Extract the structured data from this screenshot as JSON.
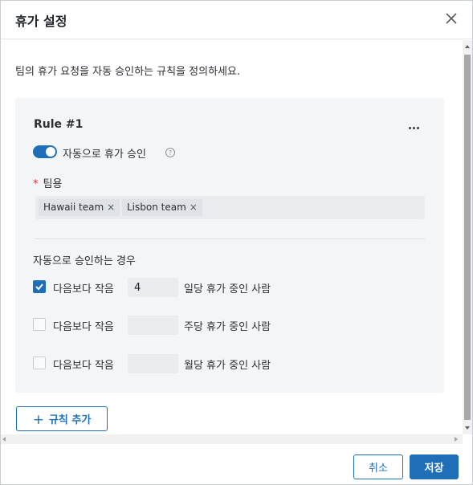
{
  "dialog": {
    "title": "휴가 설정",
    "description": "팀의 휴가 요청을 자동 승인하는 규칙을 정의하세요."
  },
  "rule": {
    "title": "Rule #1",
    "auto_approve_label": "자동으로 휴가 승인",
    "auto_approve_enabled": true,
    "help_glyph": "?",
    "required_marker": "*",
    "teams_label": "팀용",
    "teams": [
      {
        "name": "Hawaii team",
        "remove": "×"
      },
      {
        "name": "Lisbon team",
        "remove": "×"
      }
    ],
    "conditions_heading": "자동으로 승인하는 경우",
    "conditions": [
      {
        "checked": true,
        "prefix": "다음보다 작음",
        "value": "4",
        "suffix": "일당 휴가 중인 사람"
      },
      {
        "checked": false,
        "prefix": "다음보다 작음",
        "value": "",
        "suffix": "주당 휴가 중인 사람"
      },
      {
        "checked": false,
        "prefix": "다음보다 작음",
        "value": "",
        "suffix": "월당 휴가 중인 사람"
      }
    ]
  },
  "add_rule": {
    "plus": "+",
    "label": "규칙 추가"
  },
  "footer": {
    "cancel_label": "취소",
    "save_label": "저장"
  },
  "colors": {
    "accent": "#1f6fb8",
    "card_bg": "#f4f5f7",
    "required": "#d13438"
  }
}
